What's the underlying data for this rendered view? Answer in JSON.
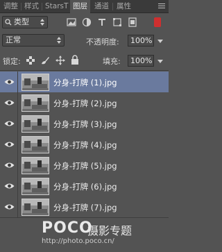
{
  "tabs": [
    {
      "label": "调整",
      "active": false
    },
    {
      "label": "样式",
      "active": false
    },
    {
      "label": "StarsT",
      "active": false
    },
    {
      "label": "图层",
      "active": true
    },
    {
      "label": "通道",
      "active": false
    },
    {
      "label": "属性",
      "active": false
    }
  ],
  "filter": {
    "kind_label": "类型"
  },
  "blend": {
    "mode": "正常",
    "opacity_label": "不透明度:",
    "opacity_value": "100%"
  },
  "lock": {
    "label": "锁定:",
    "fill_label": "填充:",
    "fill_value": "100%"
  },
  "layers": [
    {
      "name": "分身-打牌 (1).jpg",
      "selected": true
    },
    {
      "name": "分身-打牌 (2).jpg",
      "selected": false
    },
    {
      "name": "分身-打牌 (3).jpg",
      "selected": false
    },
    {
      "name": "分身-打牌 (4).jpg",
      "selected": false
    },
    {
      "name": "分身-打牌 (5).jpg",
      "selected": false
    },
    {
      "name": "分身-打牌 (6).jpg",
      "selected": false
    },
    {
      "name": "分身-打牌 (7).jpg",
      "selected": false
    }
  ],
  "watermark": {
    "logo": "POCO",
    "logo_cn": "摄影专题",
    "url": "http://photo.poco.cn/"
  }
}
